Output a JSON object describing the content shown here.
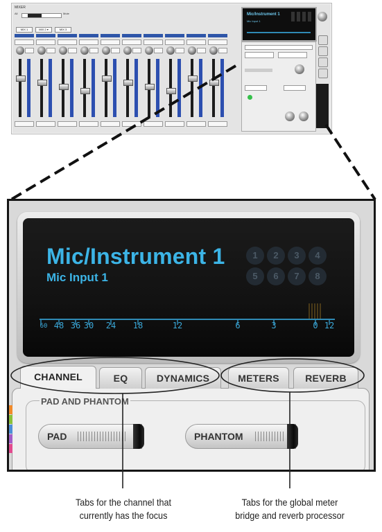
{
  "thumbnail": {
    "window_title": "MIXER",
    "sel_label": "All",
    "mix_label": "Mute",
    "tabs": [
      "MIX 1",
      "MIX 2 ▾",
      "MIX 3"
    ],
    "lcd_title": "Mic/Instrument 1",
    "lcd_subtitle": "Mic Input 1"
  },
  "display": {
    "title": "Mic/Instrument 1",
    "subtitle": "Mic Input 1",
    "channel_buttons": [
      "1",
      "2",
      "3",
      "4",
      "5",
      "6",
      "7",
      "8"
    ],
    "meter_scale": [
      "60",
      "48",
      "36",
      "30",
      "24",
      "18",
      "12",
      "6",
      "3",
      "0",
      "12"
    ]
  },
  "tabs": {
    "channel": [
      "CHANNEL",
      "EQ",
      "DYNAMICS"
    ],
    "global": [
      "METERS",
      "REVERB"
    ],
    "active": "CHANNEL"
  },
  "pad_phantom": {
    "group_title": "PAD AND PHANTOM",
    "pad_label": "PAD",
    "phantom_label": "PHANTOM"
  },
  "captions": {
    "left": [
      "Tabs for the channel that",
      "currently has the focus"
    ],
    "right": [
      "Tabs for the global meter",
      "bridge and reverb processor"
    ]
  },
  "colors": {
    "lcd_text": "#3cb4e6",
    "strip_header": "#2e55a8",
    "frame": "#161616"
  }
}
